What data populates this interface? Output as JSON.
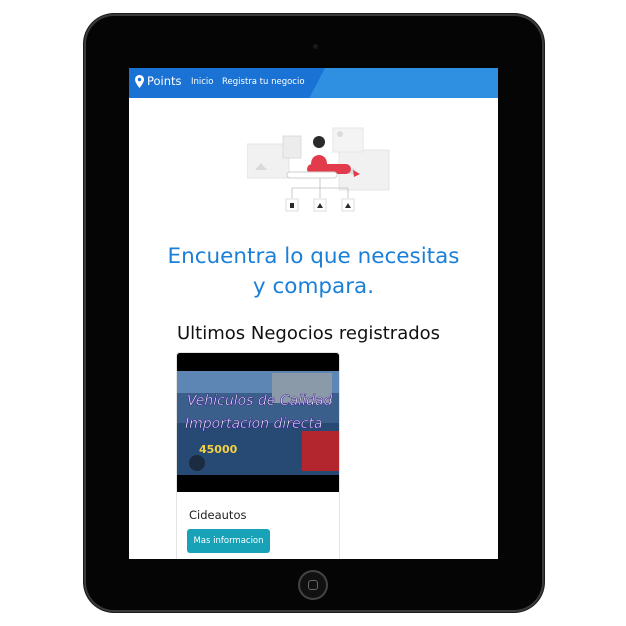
{
  "nav": {
    "brand": "Points",
    "links": [
      "Inicio",
      "Registra tu negocio"
    ]
  },
  "hero": {
    "headline_line1": "Encuentra lo que necesitas",
    "headline_line2": "y compara."
  },
  "section": {
    "title": "Ultimos Negocios registrados"
  },
  "cards": [
    {
      "image_text_line1": "Vehiculos de Calidad",
      "image_text_line2": "Importacion directa",
      "image_price": "45000",
      "title": "Cideautos",
      "button": "Mas informacion"
    }
  ],
  "colors": {
    "nav_primary": "#2f8fe0",
    "nav_dark": "#1a73d4",
    "headline": "#1a7fd8",
    "button": "#17a2b8"
  }
}
